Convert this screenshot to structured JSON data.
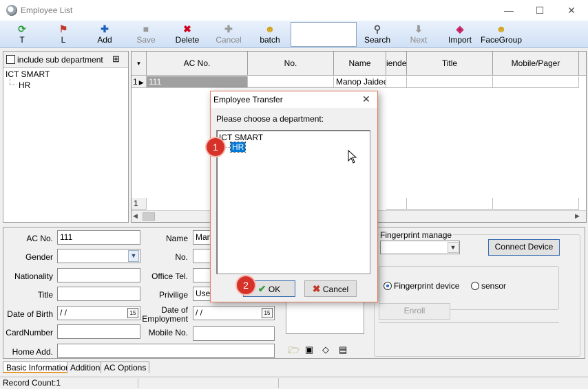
{
  "window": {
    "title": "Employee List",
    "minimize": "—",
    "maximize": "☐",
    "close": "✕"
  },
  "toolbar": {
    "items": [
      {
        "label": "T",
        "icon": "refresh-icon",
        "glyph": "⟳",
        "color": "#2e9d3c",
        "enabled": true
      },
      {
        "label": "L",
        "icon": "person-exit-icon",
        "glyph": "⚑",
        "color": "#c0392b",
        "enabled": true
      },
      {
        "label": "Add",
        "icon": "plus-icon",
        "glyph": "✚",
        "color": "#1d5fbf",
        "enabled": true
      },
      {
        "label": "Save",
        "icon": "save-icon",
        "glyph": "■",
        "color": "#9a9a9a",
        "enabled": false
      },
      {
        "label": "Delete",
        "icon": "delete-x-icon",
        "glyph": "✖",
        "color": "#d0021b",
        "enabled": true
      },
      {
        "label": "Cancel",
        "icon": "cancel-plus-icon",
        "glyph": "✚",
        "color": "#9a9a9a",
        "enabled": false
      },
      {
        "label": "batch",
        "icon": "people-group-icon",
        "glyph": "☻",
        "color": "#d4a017",
        "enabled": true
      },
      {
        "label": "Search",
        "icon": "search-icon",
        "glyph": "⚲",
        "color": "#555555",
        "enabled": true
      },
      {
        "label": "Next",
        "icon": "down-arrow-icon",
        "glyph": "⬇",
        "color": "#9a9a9a",
        "enabled": false
      },
      {
        "label": "Import",
        "icon": "import-icon",
        "glyph": "◈",
        "color": "#c2185b",
        "enabled": true
      },
      {
        "label": "FaceGroup",
        "icon": "face-group-icon",
        "glyph": "☻",
        "color": "#d4a017",
        "enabled": true
      }
    ]
  },
  "left_panel": {
    "include_sub_department": "include sub department",
    "tree": {
      "root": "ICT SMART",
      "child": "HR"
    }
  },
  "grid": {
    "columns": [
      "AC No.",
      "No.",
      "Name",
      "iende",
      "Title",
      "Mobile/Pager"
    ],
    "rows": [
      {
        "indicator": "1",
        "ac_no": "111",
        "no": "",
        "name": "Manop Jaidee",
        "iende": "",
        "title": "",
        "mobile": ""
      }
    ],
    "new_row_indicator": "1"
  },
  "form": {
    "labels": {
      "ac_no": "AC No.",
      "gender": "Gender",
      "nationality": "Nationality",
      "title": "Title",
      "date_of_birth": "Date of Birth",
      "card_number": "CardNumber",
      "home_add": "Home Add.",
      "name": "Name",
      "no": "No.",
      "office_tel": "Office Tel.",
      "privilige": "Privilige",
      "date_of_employment": "Date of Employment",
      "mobile_no": "Mobile No."
    },
    "values": {
      "ac_no": "111",
      "name": "Man",
      "privilige": "Use",
      "date_of_birth": " /  /",
      "date_of_employment": " /  /"
    },
    "fingerprint": {
      "manage_label": "Fingerprint manage",
      "connect_device": "Connect Device",
      "fingerprint_device": "Fingerprint device",
      "sensor": "sensor",
      "enroll": "Enroll"
    }
  },
  "tabs": [
    "Basic Information",
    "Addition",
    "AC Options"
  ],
  "status": {
    "record_count": "Record Count:1"
  },
  "dialog": {
    "title": "Employee Transfer",
    "prompt": "Please choose a department:",
    "tree": {
      "root": "ICT SMART",
      "child": "HR"
    },
    "ok": "OK",
    "cancel": "Cancel",
    "badge1": "1",
    "badge2": "2"
  }
}
